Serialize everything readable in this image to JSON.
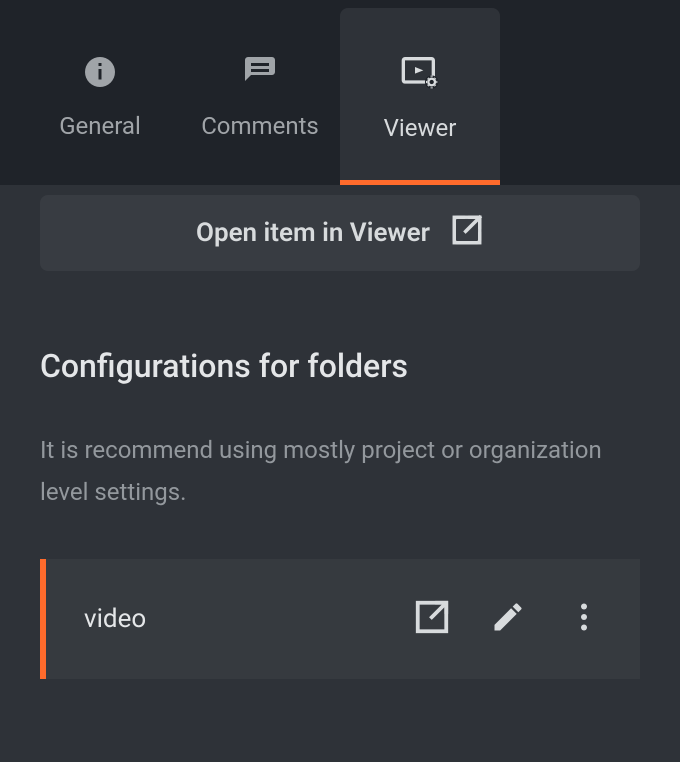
{
  "tabs": [
    {
      "label": "General"
    },
    {
      "label": "Comments"
    },
    {
      "label": "Viewer"
    }
  ],
  "open_button": {
    "label": "Open item in Viewer"
  },
  "section": {
    "title": "Configurations for folders",
    "description": "It is recommend using mostly project or organization level settings."
  },
  "configs": [
    {
      "name": "video"
    }
  ]
}
